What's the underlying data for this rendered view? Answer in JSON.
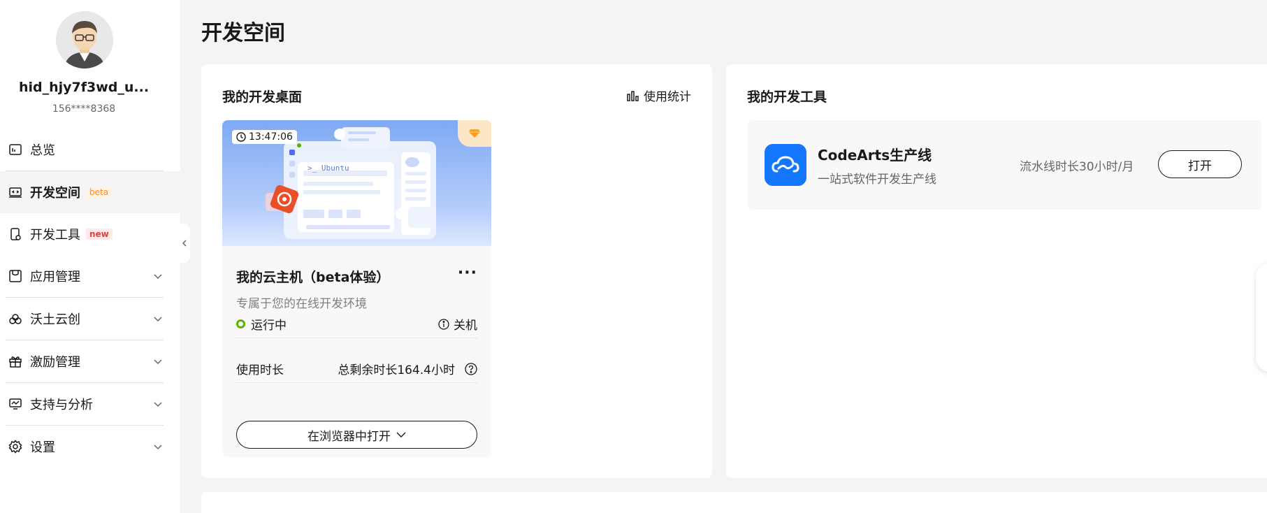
{
  "user": {
    "name": "hid_hjy7f3wd_u...",
    "phone": "156****8368"
  },
  "nav": {
    "items": [
      {
        "label": "总览",
        "icon": "dashboard-icon"
      },
      {
        "label": "开发空间",
        "icon": "code-space-icon",
        "badge": "beta",
        "active": true
      },
      {
        "label": "开发工具",
        "icon": "dev-tools-icon",
        "badge": "new"
      },
      {
        "label": "应用管理",
        "icon": "app-manage-icon",
        "expandable": true
      },
      {
        "label": "沃土云创",
        "icon": "cloud-icon",
        "expandable": true
      },
      {
        "label": "激励管理",
        "icon": "gift-icon",
        "expandable": true
      },
      {
        "label": "支持与分析",
        "icon": "monitor-icon",
        "expandable": true
      },
      {
        "label": "设置",
        "icon": "gear-icon",
        "expandable": true
      }
    ]
  },
  "page": {
    "title": "开发空间"
  },
  "desk": {
    "title": "我的开发桌面",
    "stats_label": "使用统计",
    "vm": {
      "time": "13:47:06",
      "banner_text": ">_ Ubuntu",
      "name": "我的云主机（beta体验）",
      "more": "···",
      "desc": "专属于您的在线开发环境",
      "status": "运行中",
      "shutdown": "关机",
      "usage_label": "使用时长",
      "remaining": "总剩余时长164.4小时",
      "open_btn": "在浏览器中打开"
    }
  },
  "tools": {
    "title": "我的开发工具",
    "items": [
      {
        "name": "CodeArts生产线",
        "desc": "一站式软件开发生产线",
        "quota": "流水线时长30小时/月",
        "open": "打开"
      }
    ]
  },
  "colors": {
    "accent": "#1476ff",
    "running": "#5cb300",
    "beta": "#ff8a1f",
    "new": "#e13e42"
  }
}
